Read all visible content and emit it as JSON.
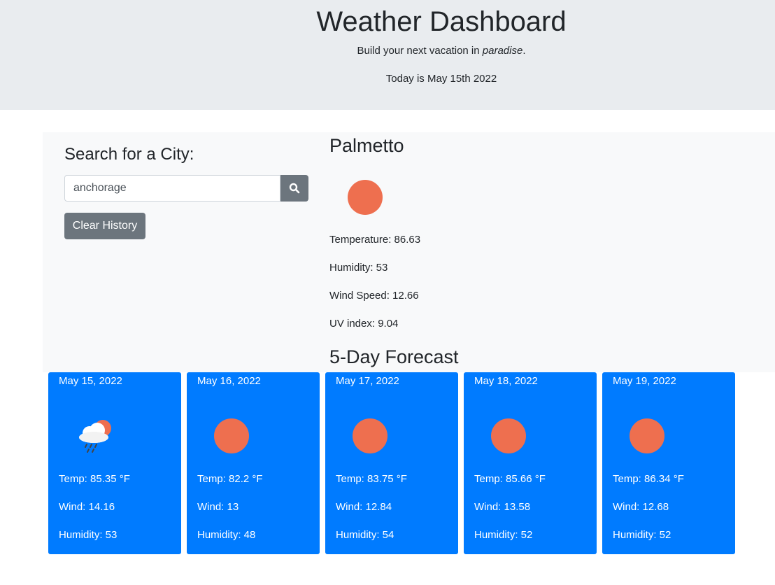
{
  "header": {
    "title": "Weather Dashboard",
    "lead_prefix": "Build your next vacation in ",
    "lead_emphasis": "paradise",
    "lead_suffix": ".",
    "today": "Today is May 15th 2022"
  },
  "search": {
    "heading": "Search for a City:",
    "input_value": "anchorage",
    "clear_label": "Clear History",
    "button_icon": "search-icon"
  },
  "current": {
    "city": "Palmetto",
    "icon": "sun-icon",
    "temperature": "Temperature: 86.63",
    "humidity": "Humidity: 53",
    "wind": "Wind Speed: 12.66",
    "uv": "UV index: 9.04"
  },
  "forecast": {
    "heading": "5-Day Forecast",
    "days": [
      {
        "date": "May 15, 2022",
        "icon": "rain-cloud-sun-icon",
        "temp": "Temp: 85.35 °F",
        "wind": "Wind: 14.16",
        "humidity": "Humidity: 53"
      },
      {
        "date": "May 16, 2022",
        "icon": "sun-icon",
        "temp": "Temp: 82.2 °F",
        "wind": "Wind: 13",
        "humidity": "Humidity: 48"
      },
      {
        "date": "May 17, 2022",
        "icon": "sun-icon",
        "temp": "Temp: 83.75 °F",
        "wind": "Wind: 12.84",
        "humidity": "Humidity: 54"
      },
      {
        "date": "May 18, 2022",
        "icon": "sun-icon",
        "temp": "Temp: 85.66 °F",
        "wind": "Wind: 13.58",
        "humidity": "Humidity: 52"
      },
      {
        "date": "May 19, 2022",
        "icon": "sun-icon",
        "temp": "Temp: 86.34 °F",
        "wind": "Wind: 12.68",
        "humidity": "Humidity: 52"
      }
    ]
  },
  "colors": {
    "header_bg": "#e9ecef",
    "panel_bg": "#f8f9fa",
    "card_bg": "#007bff",
    "sun": "#ee6f4f",
    "button_bg": "#6c757d"
  }
}
